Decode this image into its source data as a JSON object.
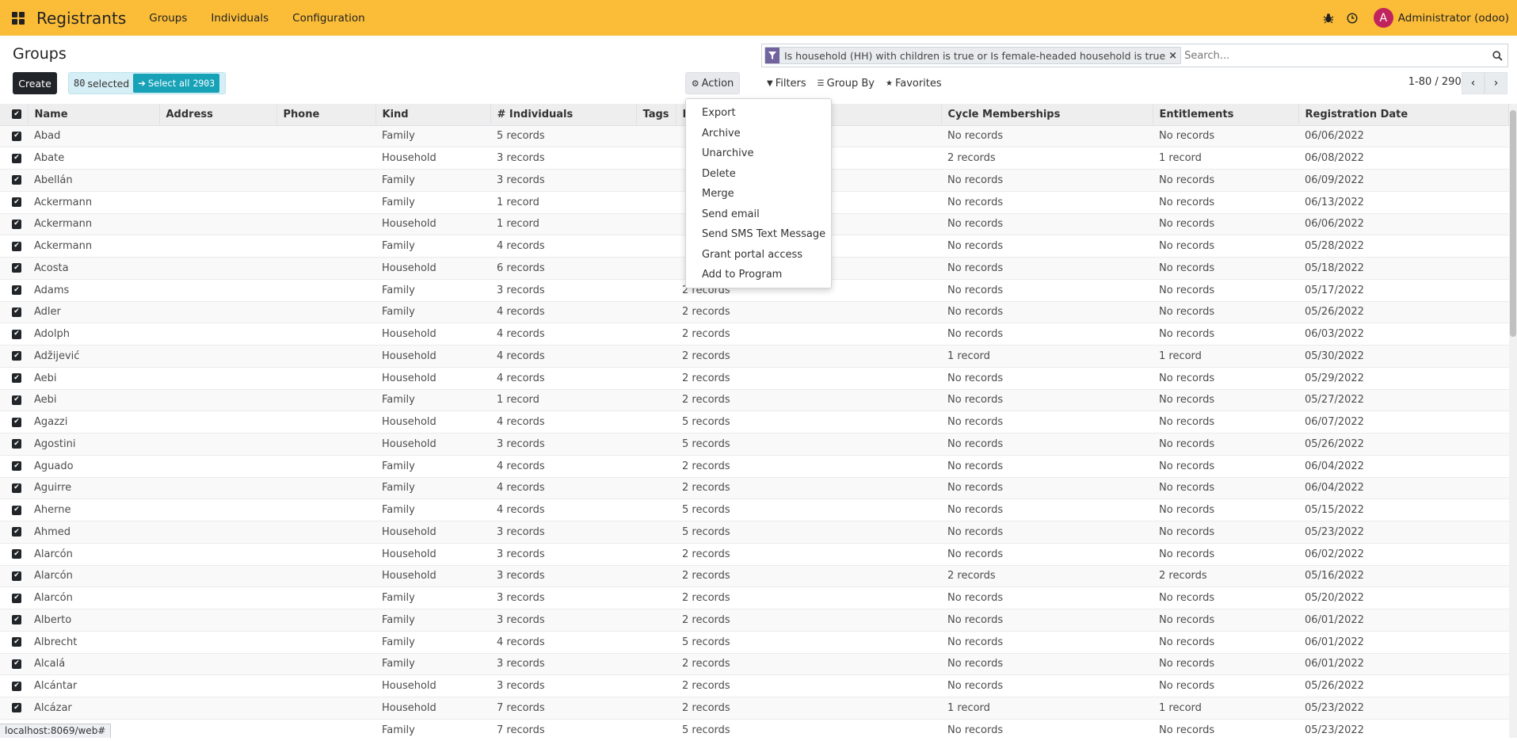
{
  "navbar": {
    "brand": "Registrants",
    "menus": [
      "Groups",
      "Individuals",
      "Configuration"
    ],
    "user": "Administrator (odoo)",
    "avatar_letter": "A",
    "avatar_color": "#c0245d",
    "bg_color": "#fbbd38"
  },
  "page_title": "Groups",
  "toolbar": {
    "create": "Create",
    "selected_count": "80",
    "selected_suffix": "selected",
    "select_all_prefix": "Select all",
    "select_all_total": "2903",
    "action": "Action"
  },
  "action_menu": [
    "Export",
    "Archive",
    "Unarchive",
    "Delete",
    "Merge",
    "Send email",
    "Send SMS Text Message",
    "Grant portal access",
    "Add to Program"
  ],
  "search": {
    "facet": "Is household (HH) with children is true or Is female-headed household is true",
    "placeholder": "Search..."
  },
  "filters": {
    "filters": "Filters",
    "group_by": "Group By",
    "favorites": "Favorites"
  },
  "pager": {
    "text": "1-80 / 2903"
  },
  "table": {
    "headers": [
      "Name",
      "Address",
      "Phone",
      "Kind",
      "# Individuals",
      "Tags",
      "Program Memberships",
      "Cycle Memberships",
      "Entitlements",
      "Registration Date"
    ],
    "rows": [
      [
        "Abad",
        "",
        "",
        "Family",
        "5 records",
        "",
        "",
        "No records",
        "No records",
        "06/06/2022"
      ],
      [
        "Abate",
        "",
        "",
        "Household",
        "3 records",
        "",
        "",
        "2 records",
        "1 record",
        "06/08/2022"
      ],
      [
        "Abellán",
        "",
        "",
        "Family",
        "3 records",
        "",
        "",
        "No records",
        "No records",
        "06/09/2022"
      ],
      [
        "Ackermann",
        "",
        "",
        "Family",
        "1 record",
        "",
        "",
        "No records",
        "No records",
        "06/13/2022"
      ],
      [
        "Ackermann",
        "",
        "",
        "Household",
        "1 record",
        "",
        "",
        "No records",
        "No records",
        "06/06/2022"
      ],
      [
        "Ackermann",
        "",
        "",
        "Family",
        "4 records",
        "",
        "",
        "No records",
        "No records",
        "05/28/2022"
      ],
      [
        "Acosta",
        "",
        "",
        "Household",
        "6 records",
        "",
        "",
        "No records",
        "No records",
        "05/18/2022"
      ],
      [
        "Adams",
        "",
        "",
        "Family",
        "3 records",
        "",
        "2 records",
        "No records",
        "No records",
        "05/17/2022"
      ],
      [
        "Adler",
        "",
        "",
        "Family",
        "4 records",
        "",
        "2 records",
        "No records",
        "No records",
        "05/26/2022"
      ],
      [
        "Adolph",
        "",
        "",
        "Household",
        "4 records",
        "",
        "2 records",
        "No records",
        "No records",
        "06/03/2022"
      ],
      [
        "Adžijević",
        "",
        "",
        "Household",
        "4 records",
        "",
        "2 records",
        "1 record",
        "1 record",
        "05/30/2022"
      ],
      [
        "Aebi",
        "",
        "",
        "Household",
        "4 records",
        "",
        "2 records",
        "No records",
        "No records",
        "05/29/2022"
      ],
      [
        "Aebi",
        "",
        "",
        "Family",
        "1 record",
        "",
        "2 records",
        "No records",
        "No records",
        "05/27/2022"
      ],
      [
        "Agazzi",
        "",
        "",
        "Household",
        "4 records",
        "",
        "5 records",
        "No records",
        "No records",
        "06/07/2022"
      ],
      [
        "Agostini",
        "",
        "",
        "Household",
        "3 records",
        "",
        "5 records",
        "No records",
        "No records",
        "05/26/2022"
      ],
      [
        "Aguado",
        "",
        "",
        "Family",
        "4 records",
        "",
        "2 records",
        "No records",
        "No records",
        "06/04/2022"
      ],
      [
        "Aguirre",
        "",
        "",
        "Family",
        "4 records",
        "",
        "2 records",
        "No records",
        "No records",
        "06/04/2022"
      ],
      [
        "Aherne",
        "",
        "",
        "Family",
        "4 records",
        "",
        "5 records",
        "No records",
        "No records",
        "05/15/2022"
      ],
      [
        "Ahmed",
        "",
        "",
        "Household",
        "3 records",
        "",
        "5 records",
        "No records",
        "No records",
        "05/23/2022"
      ],
      [
        "Alarcón",
        "",
        "",
        "Household",
        "3 records",
        "",
        "2 records",
        "No records",
        "No records",
        "06/02/2022"
      ],
      [
        "Alarcón",
        "",
        "",
        "Household",
        "3 records",
        "",
        "2 records",
        "2 records",
        "2 records",
        "05/16/2022"
      ],
      [
        "Alarcón",
        "",
        "",
        "Family",
        "3 records",
        "",
        "2 records",
        "No records",
        "No records",
        "05/20/2022"
      ],
      [
        "Alberto",
        "",
        "",
        "Family",
        "3 records",
        "",
        "2 records",
        "No records",
        "No records",
        "06/01/2022"
      ],
      [
        "Albrecht",
        "",
        "",
        "Family",
        "4 records",
        "",
        "5 records",
        "No records",
        "No records",
        "06/01/2022"
      ],
      [
        "Alcalá",
        "",
        "",
        "Family",
        "3 records",
        "",
        "2 records",
        "No records",
        "No records",
        "06/01/2022"
      ],
      [
        "Alcántar",
        "",
        "",
        "Household",
        "3 records",
        "",
        "2 records",
        "No records",
        "No records",
        "05/26/2022"
      ],
      [
        "Alcázar",
        "",
        "",
        "Household",
        "7 records",
        "",
        "2 records",
        "1 record",
        "1 record",
        "05/23/2022"
      ],
      [
        "",
        "",
        "",
        "Family",
        "7 records",
        "",
        "5 records",
        "No records",
        "No records",
        "05/23/2022"
      ]
    ]
  },
  "status_url": "localhost:8069/web#"
}
